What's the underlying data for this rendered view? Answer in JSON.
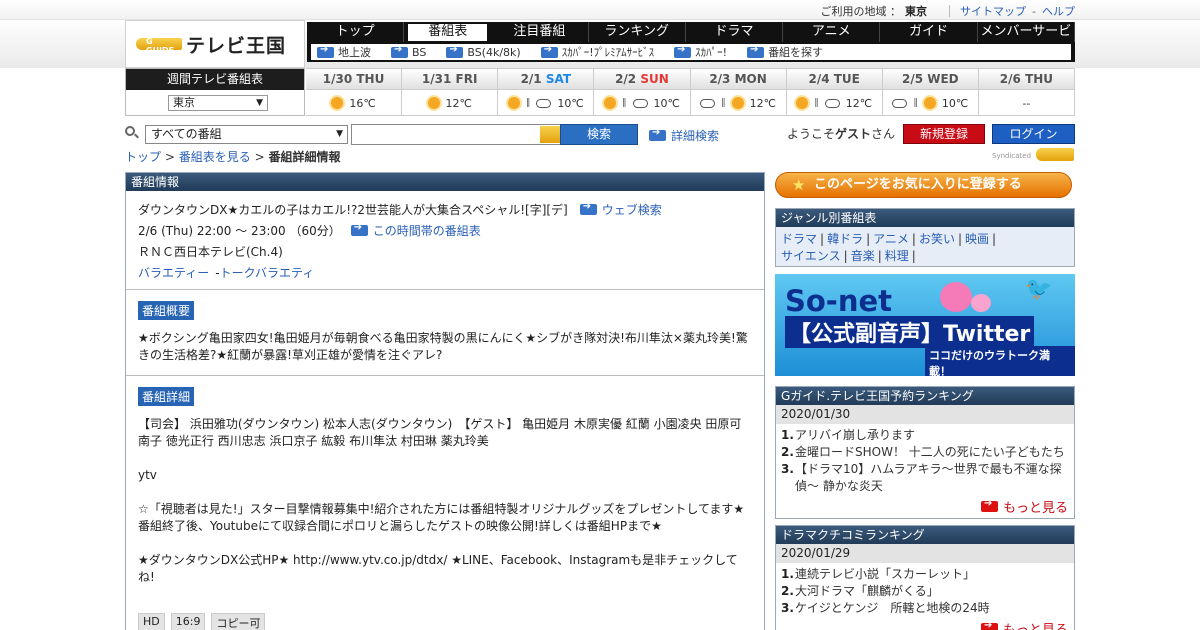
{
  "topbar": {
    "region_label": "ご利用の地域 ：",
    "region_value": "東京",
    "sitemap": "サイトマップ",
    "sep": "-",
    "help": "ヘルプ"
  },
  "logo": {
    "mark": "G GUIDE",
    "text": "テレビ王国"
  },
  "nav": {
    "top": [
      "トップ",
      "番組表",
      "注目番組",
      "ランキング",
      "ドラマ",
      "アニメ",
      "ガイド",
      "メンバーサービス"
    ],
    "active_index": 1,
    "sub": [
      "地上波",
      "BS",
      "BS(4k/8k)",
      "ｽｶﾊﾟｰ!ﾌﾟﾚﾐｱﾑｻｰﾋﾞｽ",
      "ｽｶﾊﾟｰ!",
      "番組を探す"
    ]
  },
  "week": {
    "title": "週間テレビ番組表",
    "area": "東京",
    "days": [
      {
        "date": "1/30",
        "dow": "THU",
        "color": "#555555",
        "weather": [
          "sun"
        ],
        "temp": "16℃"
      },
      {
        "date": "1/31",
        "dow": "FRI",
        "color": "#555555",
        "weather": [
          "sun"
        ],
        "temp": "12℃"
      },
      {
        "date": "2/1",
        "dow": "SAT",
        "color": "#1e88e5",
        "weather": [
          "sun",
          "cloud"
        ],
        "temp": "10℃"
      },
      {
        "date": "2/2",
        "dow": "SUN",
        "color": "#e53935",
        "weather": [
          "sun",
          "cloud"
        ],
        "temp": "10℃"
      },
      {
        "date": "2/3",
        "dow": "MON",
        "color": "#555555",
        "weather": [
          "cloud",
          "sun"
        ],
        "temp": "12℃"
      },
      {
        "date": "2/4",
        "dow": "TUE",
        "color": "#555555",
        "weather": [
          "sun",
          "cloud"
        ],
        "temp": "12℃"
      },
      {
        "date": "2/5",
        "dow": "WED",
        "color": "#555555",
        "weather": [
          "cloud",
          "sun"
        ],
        "temp": "10℃"
      },
      {
        "date": "2/6",
        "dow": "THU",
        "color": "#555555",
        "weather": [],
        "temp": "--"
      }
    ]
  },
  "search": {
    "category": "すべての番組",
    "button": "検索",
    "advanced": "詳細検索",
    "welcome_pre": "ようこそ",
    "welcome_user": "ゲスト",
    "welcome_post": "さん",
    "register": "新規登録",
    "login": "ログイン"
  },
  "breadcrumb": {
    "top": "トップ",
    "gt": ">",
    "list": "番組表を見る",
    "current": "番組詳細情報"
  },
  "syndicated": {
    "label": "Syndicated",
    "mark": "GUIDE"
  },
  "program": {
    "panel_title": "番組情報",
    "title": "ダウンタウンDX★カエルの子はカエル!?2世芸能人が大集合スペシャル![字][デ]",
    "web_search": "ウェブ検索",
    "time": "2/6 (Thu) 22:00 ～ 23:00 （60分）",
    "time_slot": "この時間帯の番組表",
    "channel": "ＲＮＣ西日本テレビ(Ch.4)",
    "genre_main": "バラエティー",
    "genre_dash": "-",
    "genre_sub": "トークバラエティ",
    "summary_tag": "番組概要",
    "summary": "★ボクシング亀田家四女!亀田姫月が毎朝食べる亀田家特製の黒にんにく★シブがき隊対決!布川隼汰×薬丸玲美!驚きの生活格差?★紅蘭が暴露!草刈正雄が愛情を注ぐアレ?",
    "detail_tag": "番組詳細",
    "detail_1": "【司会】 浜田雅功(ダウンタウン) 松本人志(ダウンタウン)　【ゲスト】 亀田姫月 木原実優 紅蘭 小園凌央 田原可南子 徳光正行 西川忠志 浜口京子 紘毅 布川隼汰 村田琳 薬丸玲美",
    "detail_2": "ytv",
    "detail_3": "☆「視聴者は見た!」スター目撃情報募集中!紹介された方には番組特製オリジナルグッズをプレゼントしてます★番組終了後、Youtubeにて収録合間にポロリと漏らしたゲストの映像公開!詳しくは番組HPまで★",
    "detail_4": "★ダウンタウンDX公式HP★ http://www.ytv.co.jp/dtdx/ ★LINE、Facebook、Instagramも是非チェックしてね!",
    "badges": [
      "HD",
      "16:9",
      "コピー可"
    ]
  },
  "sidebar": {
    "favorite": "このページをお気に入りに登録する",
    "genre_title": "ジャンル別番組表",
    "genres_row1": [
      "ドラマ",
      "韓ドラ",
      "アニメ",
      "お笑い",
      "映画"
    ],
    "genres_row2": [
      "サイエンス",
      "音楽",
      "料理"
    ],
    "genre_sep": "|",
    "banner": {
      "line1": "So-net",
      "line2": "【公式副音声】Twitter",
      "line3": "ココだけのウラトーク満載！"
    },
    "ranking1": {
      "title": "Gガイド.テレビ王国予約ランキング",
      "date": "2020/01/30",
      "items": [
        "アリバイ崩し承ります",
        "金曜ロードSHOW！ 十二人の死にたい子どもたち",
        "【ドラマ10】ハムラアキラ〜世界で最も不運な探偵〜 静かな炎天"
      ],
      "more": "もっと見る"
    },
    "ranking2": {
      "title": "ドラマクチコミランキング",
      "date": "2020/01/29",
      "items": [
        "連続テレビ小説「スカーレット」",
        "大河ドラマ「麒麟がくる」",
        "ケイジとケンジ　所轄と地検の24時"
      ],
      "more": "もっと見る"
    }
  }
}
